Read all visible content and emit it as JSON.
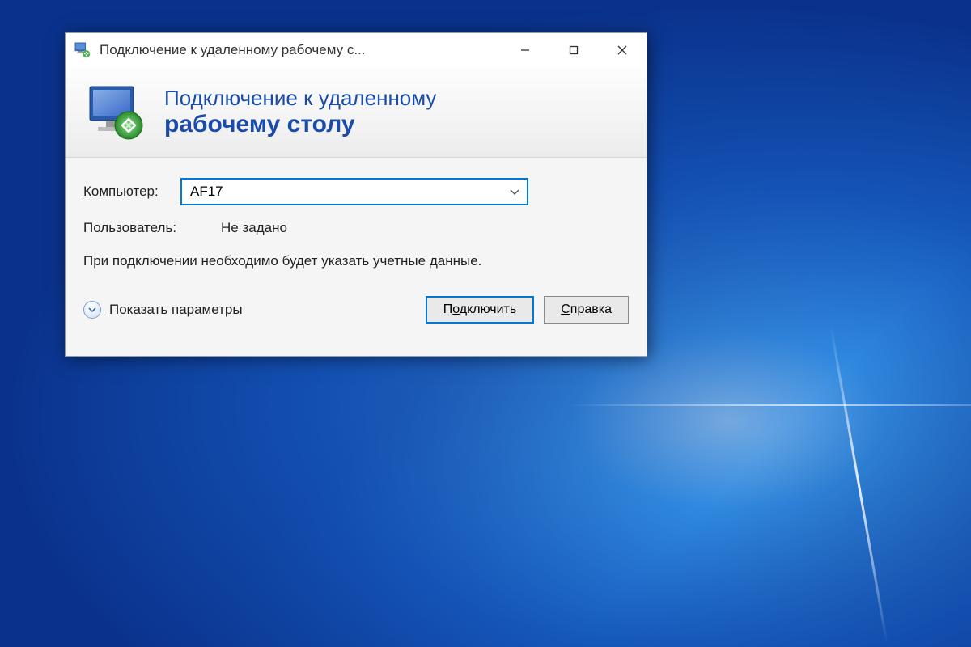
{
  "titlebar": {
    "text": "Подключение к удаленному рабочему с..."
  },
  "banner": {
    "line1": "Подключение к удаленному",
    "line2": "рабочему столу"
  },
  "form": {
    "computer_label": "омпьютер:",
    "computer_value": "AF17",
    "user_label": "Пользователь:",
    "user_value": "Не задано",
    "hint": "При подключении необходимо будет указать учетные данные."
  },
  "footer": {
    "expand_prefix": "П",
    "expand_suffix": "оказать параметры",
    "connect_prefix": "П",
    "connect_underline": "о",
    "connect_suffix": "дключить",
    "help_underline": "С",
    "help_suffix": "правка"
  }
}
